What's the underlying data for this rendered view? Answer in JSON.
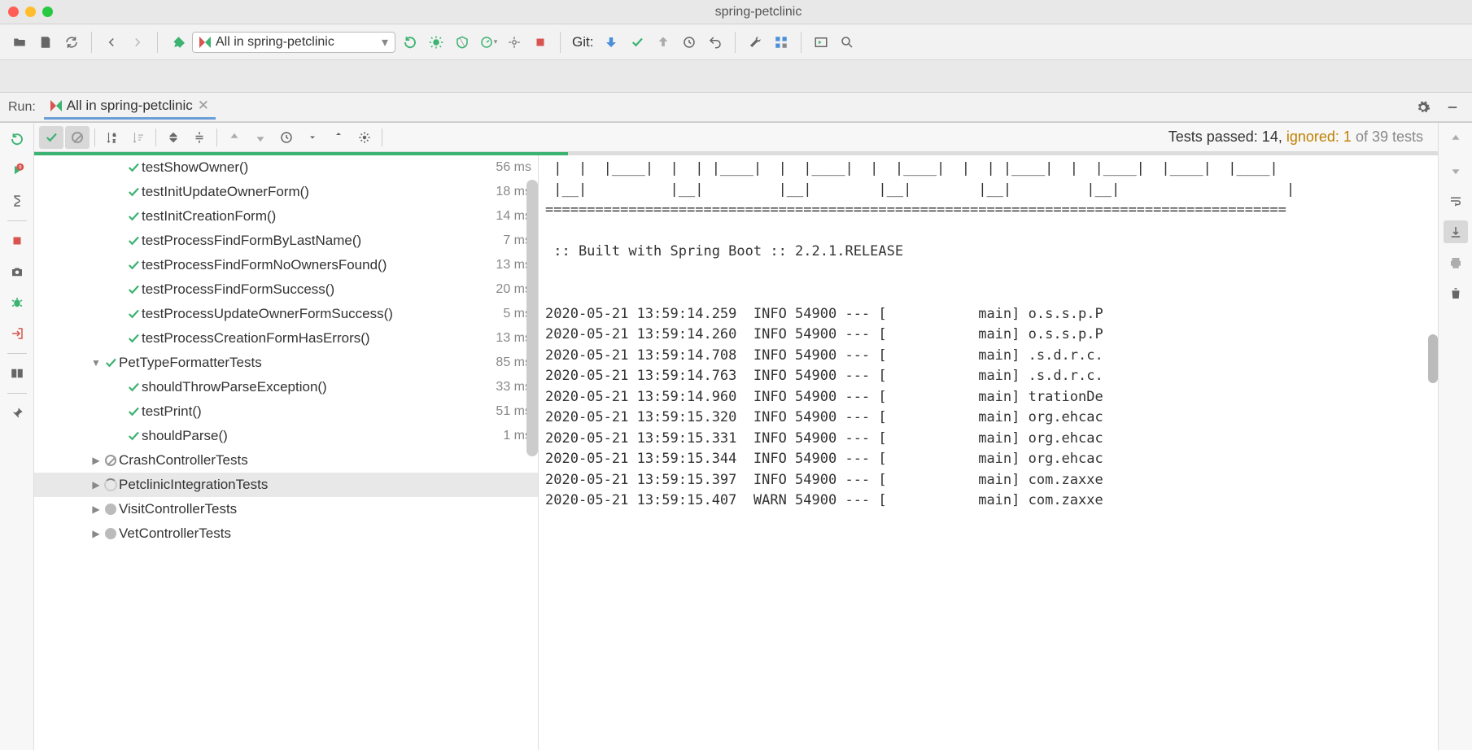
{
  "window": {
    "title": "spring-petclinic"
  },
  "toolbar": {
    "run_config_label": "All in spring-petclinic",
    "git_label": "Git:"
  },
  "run_panel": {
    "label": "Run:",
    "tab_name": "All in spring-petclinic",
    "summary": {
      "passed_text": "Tests passed: 14,",
      "ignored_text": "ignored: 1",
      "rest_text": " of 39 tests"
    },
    "progress": {
      "green_pct": 38,
      "gray_pct": 62
    }
  },
  "tree": [
    {
      "indent": 2,
      "arrow": "",
      "icon": "pass",
      "name": "testShowOwner()",
      "time": "56 ms"
    },
    {
      "indent": 2,
      "arrow": "",
      "icon": "pass",
      "name": "testInitUpdateOwnerForm()",
      "time": "18 ms"
    },
    {
      "indent": 2,
      "arrow": "",
      "icon": "pass",
      "name": "testInitCreationForm()",
      "time": "14 ms"
    },
    {
      "indent": 2,
      "arrow": "",
      "icon": "pass",
      "name": "testProcessFindFormByLastName()",
      "time": "7 ms"
    },
    {
      "indent": 2,
      "arrow": "",
      "icon": "pass",
      "name": "testProcessFindFormNoOwnersFound()",
      "time": "13 ms"
    },
    {
      "indent": 2,
      "arrow": "",
      "icon": "pass",
      "name": "testProcessFindFormSuccess()",
      "time": "20 ms"
    },
    {
      "indent": 2,
      "arrow": "",
      "icon": "pass",
      "name": "testProcessUpdateOwnerFormSuccess()",
      "time": "5 ms"
    },
    {
      "indent": 2,
      "arrow": "",
      "icon": "pass",
      "name": "testProcessCreationFormHasErrors()",
      "time": "13 ms"
    },
    {
      "indent": 1,
      "arrow": "▼",
      "icon": "pass",
      "name": "PetTypeFormatterTests",
      "time": "85 ms"
    },
    {
      "indent": 2,
      "arrow": "",
      "icon": "pass",
      "name": "shouldThrowParseException()",
      "time": "33 ms"
    },
    {
      "indent": 2,
      "arrow": "",
      "icon": "pass",
      "name": "testPrint()",
      "time": "51 ms"
    },
    {
      "indent": 2,
      "arrow": "",
      "icon": "pass",
      "name": "shouldParse()",
      "time": "1 ms"
    },
    {
      "indent": 1,
      "arrow": "▶",
      "icon": "ignored",
      "name": "CrashControllerTests",
      "time": ""
    },
    {
      "indent": 1,
      "arrow": "▶",
      "icon": "spinner",
      "name": "PetclinicIntegrationTests",
      "time": "",
      "selected": true
    },
    {
      "indent": 1,
      "arrow": "▶",
      "icon": "pending",
      "name": "VisitControllerTests",
      "time": ""
    },
    {
      "indent": 1,
      "arrow": "▶",
      "icon": "pending",
      "name": "VetControllerTests",
      "time": ""
    }
  ],
  "console": {
    "lines": [
      " |  |  |____|  |  | |____|  |  |____|  |  |____|  |  | |____|  |  |____|  |____|  |____| ",
      " |__|          |__|         |__|        |__|        |__|         |__|                    |",
      "=========================================================================================",
      "",
      " :: Built with Spring Boot :: 2.2.1.RELEASE",
      "",
      "",
      "2020-05-21 13:59:14.259  INFO 54900 --- [           main] o.s.s.p.P",
      "2020-05-21 13:59:14.260  INFO 54900 --- [           main] o.s.s.p.P",
      "2020-05-21 13:59:14.708  INFO 54900 --- [           main] .s.d.r.c.",
      "2020-05-21 13:59:14.763  INFO 54900 --- [           main] .s.d.r.c.",
      "2020-05-21 13:59:14.960  INFO 54900 --- [           main] trationDe",
      "2020-05-21 13:59:15.320  INFO 54900 --- [           main] org.ehcac",
      "2020-05-21 13:59:15.331  INFO 54900 --- [           main] org.ehcac",
      "2020-05-21 13:59:15.344  INFO 54900 --- [           main] org.ehcac",
      "2020-05-21 13:59:15.397  INFO 54900 --- [           main] com.zaxxe",
      "2020-05-21 13:59:15.407  WARN 54900 --- [           main] com.zaxxe"
    ]
  }
}
